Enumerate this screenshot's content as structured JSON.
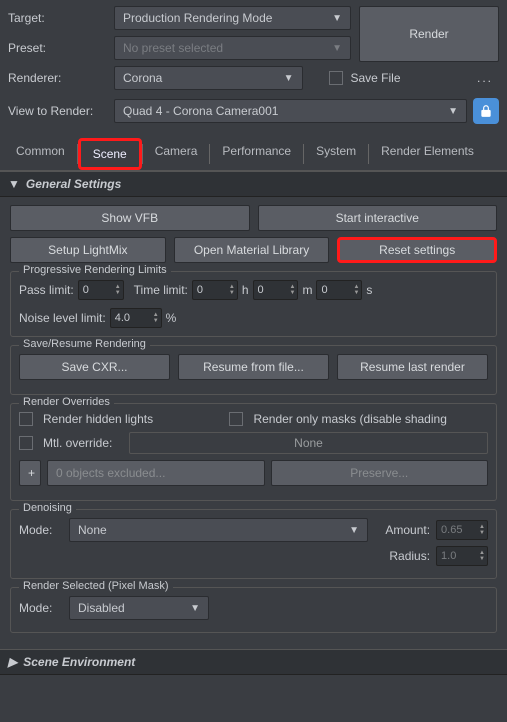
{
  "top": {
    "targetLabel": "Target:",
    "targetValue": "Production Rendering Mode",
    "presetLabel": "Preset:",
    "presetValue": "No preset selected",
    "rendererLabel": "Renderer:",
    "rendererValue": "Corona",
    "renderBtn": "Render",
    "saveFile": "Save File",
    "dots": "...",
    "viewLabel": "View to Render:",
    "viewValue": "Quad 4 - Corona Camera001"
  },
  "tabs": {
    "common": "Common",
    "scene": "Scene",
    "camera": "Camera",
    "performance": "Performance",
    "system": "System",
    "renderElements": "Render Elements"
  },
  "general": {
    "title": "General Settings",
    "showVFB": "Show VFB",
    "startInteractive": "Start interactive",
    "setupLightMix": "Setup LightMix",
    "openMatLib": "Open Material Library",
    "resetSettings": "Reset settings",
    "progTitle": "Progressive Rendering Limits",
    "passLimitLabel": "Pass limit:",
    "passLimit": "0",
    "timeLimitLabel": "Time limit:",
    "timeH": "0",
    "h": "h",
    "timeM": "0",
    "m": "m",
    "timeS": "0",
    "s": "s",
    "noiseLabel": "Noise level limit:",
    "noiseVal": "4.0",
    "pct": "%",
    "saveResumeTitle": "Save/Resume Rendering",
    "saveCXR": "Save CXR...",
    "resumeFile": "Resume from file...",
    "resumeLast": "Resume last render",
    "overridesTitle": "Render Overrides",
    "renderHidden": "Render hidden lights",
    "renderMasks": "Render only masks (disable shading",
    "mtlOverride": "Mtl. override:",
    "none": "None",
    "plus": "+",
    "excluded": "0 objects excluded...",
    "preserve": "Preserve...",
    "denoiseTitle": "Denoising",
    "modeLabel": "Mode:",
    "modeNone": "None",
    "amountLabel": "Amount:",
    "amountVal": "0.65",
    "radiusLabel": "Radius:",
    "radiusVal": "1.0",
    "rsTitle": "Render Selected (Pixel Mask)",
    "rsMode": "Disabled"
  },
  "sceneEnv": {
    "title": "Scene Environment"
  }
}
